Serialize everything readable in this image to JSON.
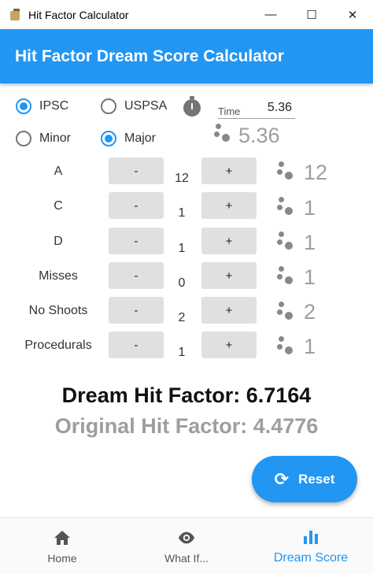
{
  "window": {
    "title": "Hit Factor Calculator",
    "min": "—",
    "max": "☐",
    "close": "✕"
  },
  "appbar": {
    "title": "Hit Factor Dream Score Calculator"
  },
  "options": {
    "ipsc": "IPSC",
    "uspsa": "USPSA",
    "minor": "Minor",
    "major": "Major",
    "selected_org": "IPSC",
    "selected_power": "Major"
  },
  "time": {
    "label": "Time",
    "value": "5.36",
    "display": "5.36"
  },
  "rows": [
    {
      "label": "A",
      "count": "12",
      "display": "12"
    },
    {
      "label": "C",
      "count": "1",
      "display": "1"
    },
    {
      "label": "D",
      "count": "1",
      "display": "1"
    },
    {
      "label": "Misses",
      "count": "0",
      "display": "1"
    },
    {
      "label": "No Shoots",
      "count": "2",
      "display": "2"
    },
    {
      "label": "Procedurals",
      "count": "1",
      "display": "1"
    }
  ],
  "buttons": {
    "minus": "-",
    "plus": "+"
  },
  "results": {
    "dream": "Dream Hit Factor: 6.7164",
    "original": "Original Hit Factor: 4.4776"
  },
  "reset": {
    "label": "Reset",
    "icon": "refresh-icon"
  },
  "nav": [
    {
      "label": "Home",
      "icon": "home-icon"
    },
    {
      "label": "What If...",
      "icon": "eye-icon"
    },
    {
      "label": "Dream Score",
      "icon": "bar-chart-icon"
    }
  ],
  "colors": {
    "primary": "#2196f3",
    "muted": "#9e9e9e"
  }
}
